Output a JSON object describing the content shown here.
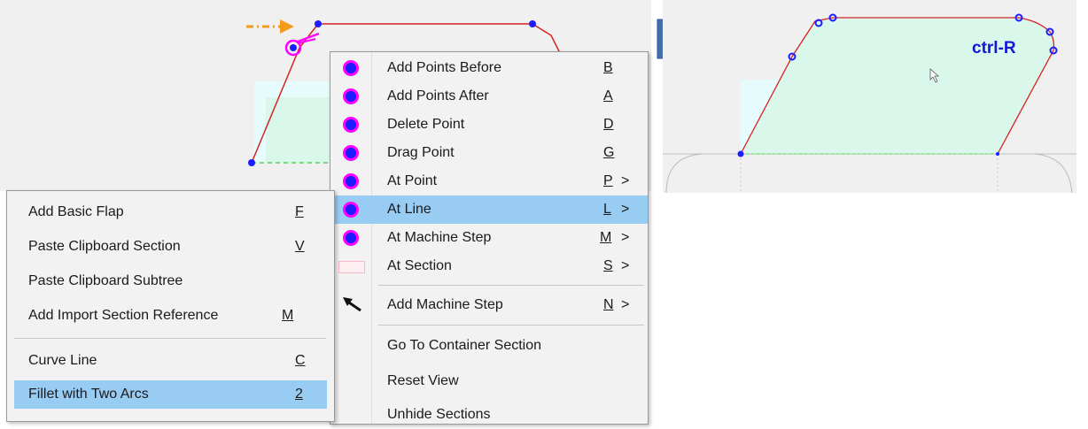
{
  "right_panel": {
    "shortcut_label": "ctrl-R"
  },
  "left_menu": {
    "items": [
      {
        "label": "Add Basic Flap",
        "key": "F"
      },
      {
        "label": "Paste Clipboard Section",
        "key": "V"
      },
      {
        "label": "Paste Clipboard Subtree",
        "key": ""
      },
      {
        "label": "Add Import Section Reference",
        "key": "M"
      },
      {
        "label": "Curve Line",
        "key": "C"
      },
      {
        "label": "Fillet with Two Arcs",
        "key": "2"
      }
    ]
  },
  "context_menu": {
    "items": [
      {
        "label": "Add Points Before",
        "key": "B",
        "arrow": ""
      },
      {
        "label": "Add Points After",
        "key": "A",
        "arrow": ""
      },
      {
        "label": "Delete Point",
        "key": "D",
        "arrow": ""
      },
      {
        "label": "Drag Point",
        "key": "G",
        "arrow": ""
      },
      {
        "label": "At Point",
        "key": "P",
        "arrow": ">"
      },
      {
        "label": "At Line",
        "key": "L",
        "arrow": ">"
      },
      {
        "label": "At Machine Step",
        "key": "M",
        "arrow": ">"
      },
      {
        "label": "At Section",
        "key": "S",
        "arrow": ">"
      },
      {
        "label": "Add Machine Step",
        "key": "N",
        "arrow": ">"
      },
      {
        "label": "Go To Container Section",
        "key": "",
        "arrow": ""
      },
      {
        "label": "Reset View",
        "key": "",
        "arrow": ""
      },
      {
        "label": "Unhide Sections",
        "key": "",
        "arrow": ""
      }
    ]
  },
  "colors": {
    "highlight": "#99ccf3",
    "bullet_ring": "#ff00ff",
    "bullet_fill": "#1c1cff",
    "profile_line": "#d42424",
    "fill": "#d9f7ea",
    "accent_arrow": "#3f6fb5"
  }
}
